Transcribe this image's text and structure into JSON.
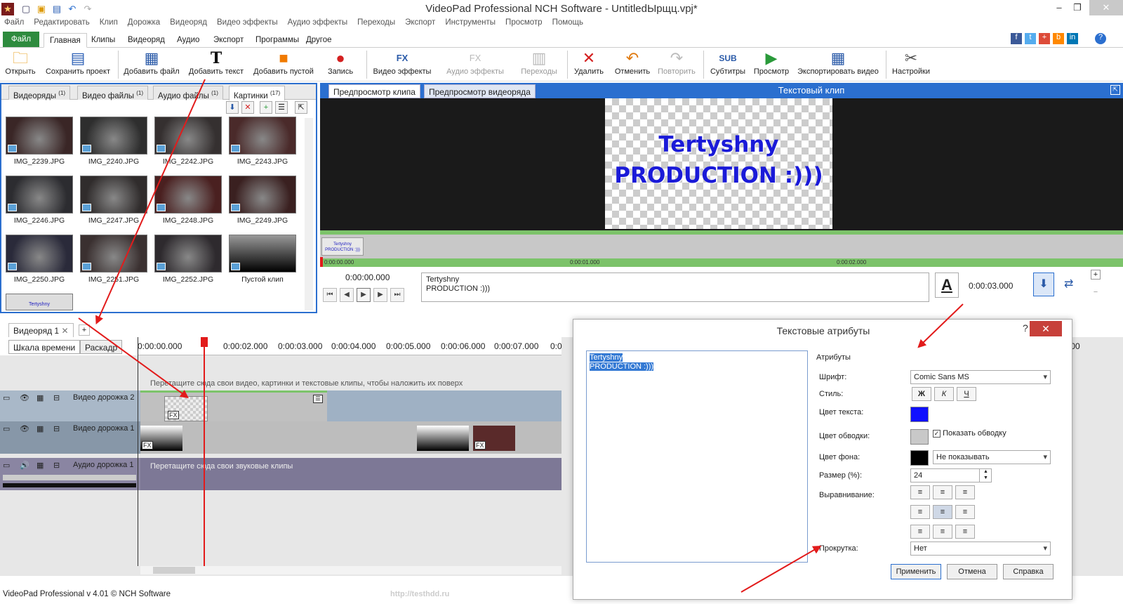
{
  "window": {
    "title": "VideoPad Professional NCH Software - UntitledЫрщц.vpj*",
    "minimize": "–",
    "maximize": "❐",
    "close": "✕"
  },
  "menu": [
    "Файл",
    "Редактировать",
    "Клип",
    "Дорожка",
    "Видеоряд",
    "Видео эффекты",
    "Аудио эффекты",
    "Переходы",
    "Экспорт",
    "Инструменты",
    "Просмотр",
    "Помощь"
  ],
  "ribbon_tabs": [
    "Файл",
    "Главная",
    "Клипы",
    "Видеоряд",
    "Аудио",
    "Экспорт",
    "Программы",
    "Другое"
  ],
  "toolbar": [
    "Открыть",
    "Сохранить проект",
    "Добавить файл",
    "Добавить текст",
    "Добавить пустой",
    "Запись",
    "Видео эффекты",
    "Аудио эффекты",
    "Переходы",
    "Удалить",
    "Отменить",
    "Повторить",
    "Субтитры",
    "Просмотр",
    "Экспортировать видео",
    "Настройки"
  ],
  "media_tabs": [
    {
      "label": "Видеоряды",
      "count": "(1)"
    },
    {
      "label": "Видео файлы",
      "count": "(1)"
    },
    {
      "label": "Аудио файлы",
      "count": "(1)"
    },
    {
      "label": "Картинки",
      "count": "(17)"
    }
  ],
  "media_items": [
    "IMG_2239.JPG",
    "IMG_2240.JPG",
    "IMG_2242.JPG",
    "IMG_2243.JPG",
    "IMG_2246.JPG",
    "IMG_2247.JPG",
    "IMG_2248.JPG",
    "IMG_2249.JPG",
    "IMG_2250.JPG",
    "IMG_2251.JPG",
    "IMG_2252.JPG",
    "Пустой клип"
  ],
  "text_thumb_label": "Tertyshny",
  "preview": {
    "tab_clip": "Предпросмотр клипа",
    "tab_sequence": "Предпросмотр видеоряда",
    "title": "Текстовый клип",
    "line1": "Tertyshny",
    "line2": "PRODUCTION :)))",
    "strip_label": "Tertyshny PRODUCTION :)))",
    "ruler": [
      "0:00:00.000",
      "0:00:01.000",
      "0:00:02.000"
    ],
    "time": "0:00:00.000",
    "duration": "0:00:03.000",
    "text_line1": "Tertyshny",
    "text_line2": "PRODUCTION :)))"
  },
  "timeline": {
    "tab": "Видеоряд 1",
    "view_timeline": "Шкала времени",
    "view_storyboard": "Раскадр",
    "ruler": [
      "0:00:00.000",
      "0:00:02.000",
      "0:00:03.000",
      "0:00:04.000",
      "0:00:05.000",
      "0:00:06.000",
      "0:00:07.000",
      "0:0"
    ],
    "ruler_end": "17.000",
    "hint_video": "Перетащите сюда свои видео, картинки и текстовые клипы, чтобы наложить их поверх",
    "video_track2": "Видео дорожка 2",
    "video_track1": "Видео дорожка 1",
    "audio_track1": "Аудио дорожка 1",
    "hint_audio": "Перетащите сюда свои звуковые клипы",
    "fx": "FX"
  },
  "dialog": {
    "title": "Текстовые атрибуты",
    "help": "?",
    "text1": "Tertyshny",
    "text2": "PRODUCTION :)))",
    "attrs": "Атрибуты",
    "font_label": "Шрифт:",
    "font_value": "Comic Sans MS",
    "style_label": "Стиль:",
    "bold": "Ж",
    "italic": "К",
    "underline": "Ч",
    "text_color_label": "Цвет текста:",
    "text_color": "#1010ff",
    "outline_label": "Цвет обводки:",
    "outline_check": "Показать обводку",
    "bg_label": "Цвет фона:",
    "bg_value": "Не показывать",
    "size_label": "Размер (%):",
    "size_value": "24",
    "align_label": "Выравнивание:",
    "scroll_label": "Прокрутка:",
    "scroll_value": "Нет",
    "apply": "Применить",
    "cancel": "Отмена",
    "help_btn": "Справка"
  },
  "status": "VideoPad Professional v 4.01 © NCH Software",
  "watermark": "http://testhdd.ru"
}
